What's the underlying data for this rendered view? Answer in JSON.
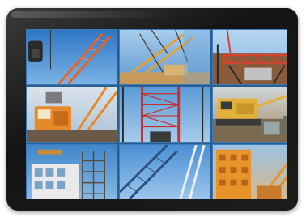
{
  "device": {
    "type": "tablet"
  },
  "screen": {
    "layout": "3x3 image grid",
    "divider_color": "#3d7ab8",
    "tiles": [
      {
        "icon": "crane-arm-image",
        "accent": "#e2632b",
        "sky": "#4b8fd0"
      },
      {
        "icon": "crane-boom-image",
        "accent": "#e0a33a",
        "sky": "#7fb3e4"
      },
      {
        "icon": "steel-truss-image",
        "accent": "#d8412f",
        "sky": "#8fc0e8"
      },
      {
        "icon": "crane-cab-image",
        "accent": "#e58a2a",
        "sky": "#c7d4e0"
      },
      {
        "icon": "red-lattice-tower-image",
        "accent": "#c8302a",
        "sky": "#6fa6d8"
      },
      {
        "icon": "crawler-crane-image",
        "accent": "#e2b13a",
        "sky": "#d9c9a8"
      },
      {
        "icon": "building-scaffold-image",
        "accent": "#7aa3c9",
        "sky": "#5b97d1"
      },
      {
        "icon": "lattice-jib-image",
        "accent": "#2c4f82",
        "sky": "#5d9ad6"
      },
      {
        "icon": "orange-crane-image",
        "accent": "#e8942c",
        "sky": "#d8b88a"
      }
    ]
  }
}
